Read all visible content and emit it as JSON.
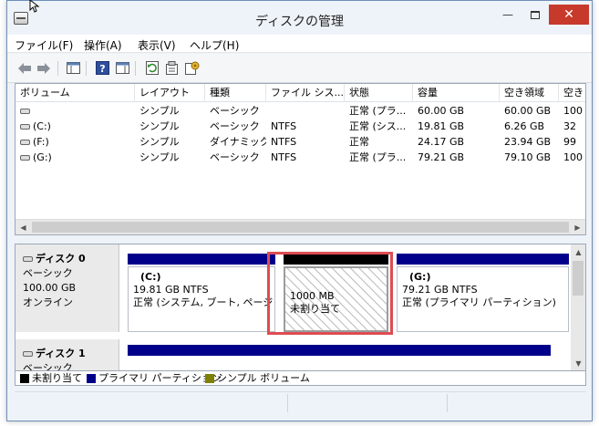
{
  "window": {
    "title": "ディスクの管理",
    "minimize": "—",
    "close": "✕"
  },
  "menu": [
    "ファイル(F)",
    "操作(A)",
    "表示(V)",
    "ヘルプ(H)"
  ],
  "toolbar_icons": [
    "back-arrow-icon",
    "forward-arrow-icon",
    "console-tree-icon",
    "help-icon",
    "action-pane-icon",
    "refresh-icon",
    "properties-icon",
    "settings-icon"
  ],
  "list": {
    "columns": [
      "ボリューム",
      "レイアウト",
      "種類",
      "ファイル シス...",
      "状態",
      "容量",
      "空き領域",
      "空き"
    ],
    "rows": [
      {
        "volume": "",
        "layout": "シンプル",
        "type": "ベーシック",
        "fs": "",
        "status": "正常 (プラ...",
        "capacity": "60.00 GB",
        "free": "60.00 GB",
        "pct": "100"
      },
      {
        "volume": "(C:)",
        "layout": "シンプル",
        "type": "ベーシック",
        "fs": "NTFS",
        "status": "正常 (シス...",
        "capacity": "19.81 GB",
        "free": "6.26 GB",
        "pct": "32"
      },
      {
        "volume": "(F:)",
        "layout": "シンプル",
        "type": "ダイナミック",
        "fs": "NTFS",
        "status": "正常",
        "capacity": "24.17 GB",
        "free": "23.94 GB",
        "pct": "99"
      },
      {
        "volume": "(G:)",
        "layout": "シンプル",
        "type": "ベーシック",
        "fs": "NTFS",
        "status": "正常 (プラ...",
        "capacity": "79.21 GB",
        "free": "79.10 GB",
        "pct": "100"
      }
    ]
  },
  "disks": [
    {
      "name": "ディスク 0",
      "type": "ベーシック",
      "size": "100.00 GB",
      "state": "オンライン",
      "partitions": [
        {
          "name": "(C:)",
          "size": "19.81 GB NTFS",
          "status": "正常 (システム, ブート, ページ フ"
        },
        {
          "name": "",
          "size": "1000 MB",
          "status": "未割り当て"
        },
        {
          "name": "(G:)",
          "size": "79.21 GB NTFS",
          "status": "正常 (プライマリ パーティション)"
        }
      ]
    },
    {
      "name": "ディスク 1",
      "type": "ベーシック"
    }
  ],
  "legend": [
    {
      "label": "未割り当て",
      "color": "#000000"
    },
    {
      "label": "プライマリ パーティション",
      "color": "#00008b"
    },
    {
      "label": "シンプル ボリューム",
      "color": "#808000"
    }
  ],
  "colors": {
    "primary_bar": "#00008b",
    "unallocated_bar": "#000000",
    "highlight": "#de4c53"
  }
}
